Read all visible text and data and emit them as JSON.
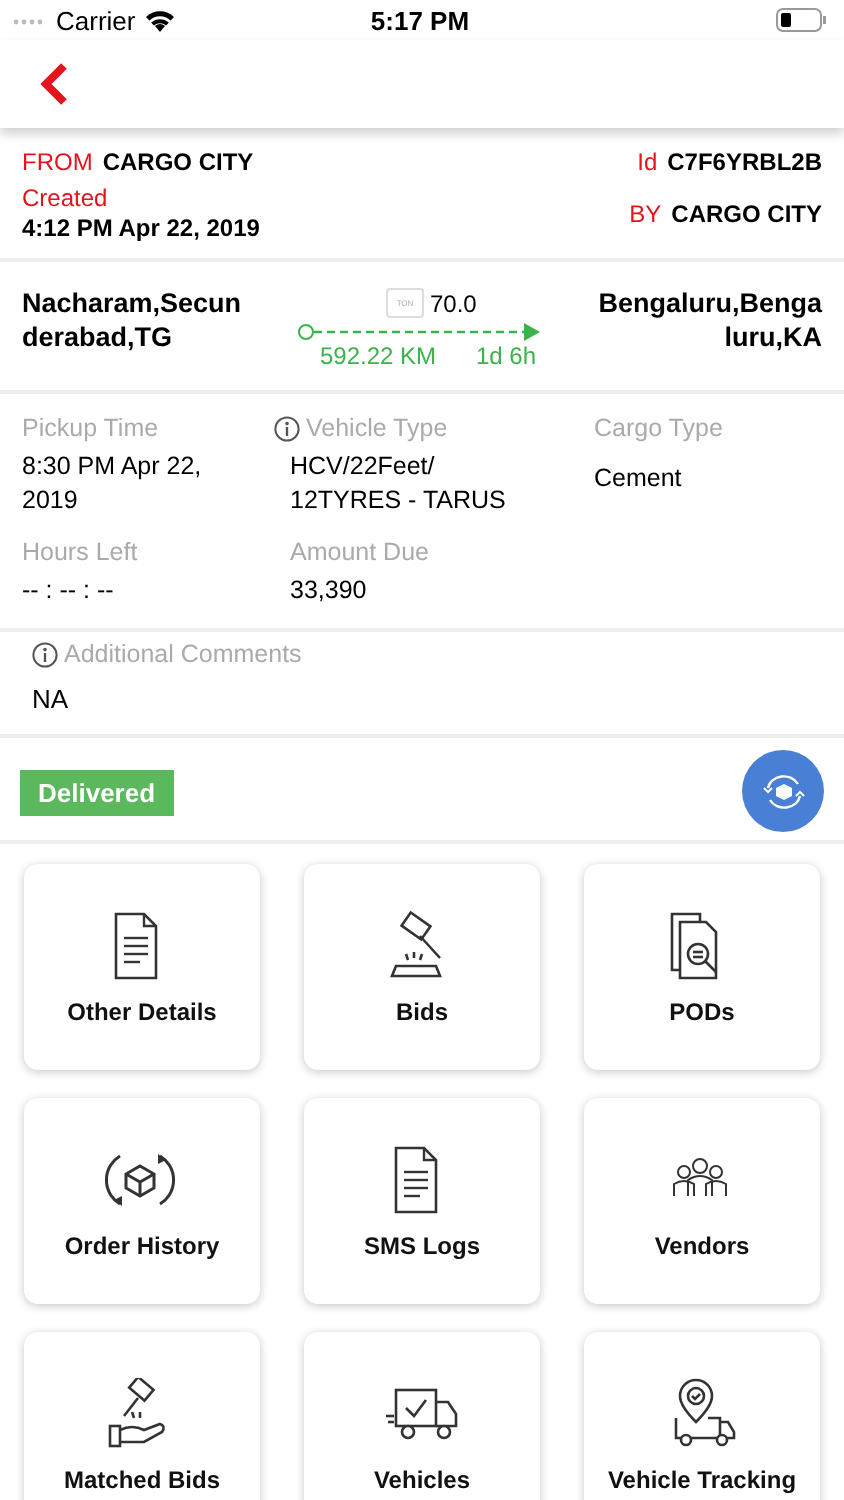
{
  "status_bar": {
    "carrier": "Carrier",
    "time": "5:17 PM"
  },
  "order": {
    "from_label": "FROM",
    "from": "CARGO CITY",
    "id_label": "Id",
    "id": "C7F6YRBL2B",
    "created_label": "Created",
    "created": "4:12 PM Apr 22, 2019",
    "by_label": "BY",
    "by": "CARGO CITY"
  },
  "route": {
    "origin": "Nacharam,Secunderabad,TG",
    "destination": "Bengaluru,Bengaluru,KA",
    "weight_unit": "TON",
    "weight": "70.0",
    "distance": "592.22 KM",
    "duration": "1d 6h"
  },
  "details": [
    {
      "label": "Pickup Time",
      "value": "8:30 PM Apr 22, 2019",
      "info": false
    },
    {
      "label": "Vehicle Type",
      "value": "HCV/22Feet/ 12TYRES - TARUS",
      "info": true
    },
    {
      "label": "Cargo Type",
      "value": "Cement",
      "info": false
    },
    {
      "label": "Hours Left",
      "value": "-- : -- : --",
      "info": false
    },
    {
      "label": "Amount Due",
      "value": "33,390",
      "info": false
    }
  ],
  "comments": {
    "label": "Additional Comments",
    "info": true,
    "value": "NA"
  },
  "status": {
    "label": "Delivered",
    "color": "#5cb85c"
  },
  "tiles": [
    {
      "label": "Other Details",
      "kind": "document"
    },
    {
      "label": "Bids",
      "kind": "gavel"
    },
    {
      "label": "PODs",
      "kind": "docsearch"
    },
    {
      "label": "Order History",
      "kind": "boxcycle"
    },
    {
      "label": "SMS Logs",
      "kind": "document"
    },
    {
      "label": "Vendors",
      "kind": "people"
    },
    {
      "label": "Matched Bids",
      "kind": "gavelhand"
    },
    {
      "label": "Vehicles",
      "kind": "truckcheck"
    },
    {
      "label": "Vehicle Tracking",
      "kind": "pintruck"
    }
  ]
}
